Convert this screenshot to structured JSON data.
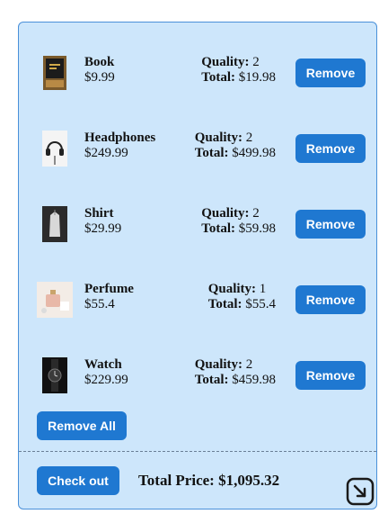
{
  "cart": {
    "items": [
      {
        "name": "Book",
        "price": "$9.99",
        "quality_label": "Quality:",
        "quality": "2",
        "total_label": "Total:",
        "total": "$19.98",
        "remove_label": "Remove",
        "icon": "book-icon"
      },
      {
        "name": "Headphones",
        "price": "$249.99",
        "quality_label": "Quality:",
        "quality": "2",
        "total_label": "Total:",
        "total": "$499.98",
        "remove_label": "Remove",
        "icon": "headphones-icon"
      },
      {
        "name": "Shirt",
        "price": "$29.99",
        "quality_label": "Quality:",
        "quality": "2",
        "total_label": "Total:",
        "total": "$59.98",
        "remove_label": "Remove",
        "icon": "shirt-icon"
      },
      {
        "name": "Perfume",
        "price": "$55.4",
        "quality_label": "Quality:",
        "quality": "1",
        "total_label": "Total:",
        "total": "$55.4",
        "remove_label": "Remove",
        "icon": "perfume-icon"
      },
      {
        "name": "Watch",
        "price": "$229.99",
        "quality_label": "Quality:",
        "quality": "2",
        "total_label": "Total:",
        "total": "$459.98",
        "remove_label": "Remove",
        "icon": "watch-icon"
      }
    ],
    "remove_all_label": "Remove All",
    "checkout_label": "Check out",
    "total_price_label": "Total Price:",
    "total_price": "$1,095.32"
  },
  "colors": {
    "panel_background": "#cde6fb",
    "panel_border": "#4a90d9",
    "button": "#1f78d1",
    "button_text": "#ffffff"
  }
}
